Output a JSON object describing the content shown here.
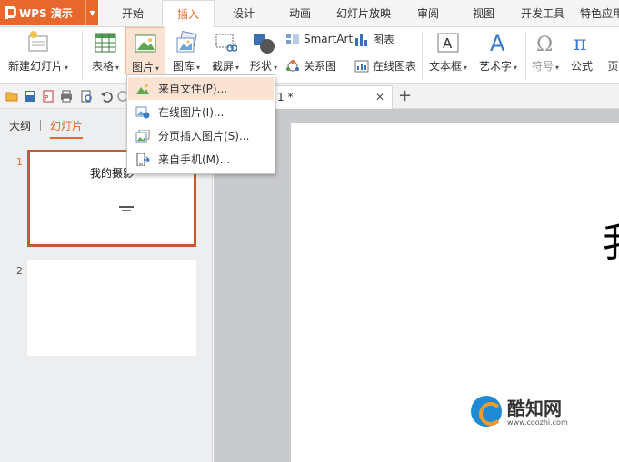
{
  "app": {
    "name": "WPS 演示",
    "dropdown_icon": "caret-down-icon"
  },
  "menu_tabs": [
    "开始",
    "插入",
    "设计",
    "动画",
    "幻灯片放映",
    "审阅",
    "视图",
    "开发工具",
    "特色应用"
  ],
  "active_tab": "插入",
  "ribbon": {
    "new_slide": "新建幻灯片",
    "table": "表格",
    "picture": "图片",
    "gallery": "图库",
    "screenshot": "截屏",
    "shapes": "形状",
    "smartart": "SmartArt",
    "chart": "图表",
    "relation": "关系图",
    "online_chart": "在线图表",
    "textbox": "文本框",
    "wordart": "艺术字",
    "symbol": "符号",
    "formula": "公式",
    "more": "页"
  },
  "document_tab": {
    "title": "1 *"
  },
  "left_pane": {
    "tabs": [
      "大纲",
      "幻灯片"
    ],
    "active_tab": "幻灯片",
    "slides": [
      {
        "number": "1",
        "title": "我的摄影"
      },
      {
        "number": "2",
        "title": ""
      }
    ]
  },
  "slide_canvas": {
    "visible_char": "我"
  },
  "picture_menu": {
    "items": [
      {
        "label": "来自文件(P)...",
        "icon": "image-file-icon"
      },
      {
        "label": "在线图片(I)...",
        "icon": "online-image-icon"
      },
      {
        "label": "分页插入图片(S)...",
        "icon": "paged-image-icon"
      },
      {
        "label": "来自手机(M)...",
        "icon": "phone-icon"
      }
    ]
  },
  "watermark": {
    "name": "酷知网",
    "url": "www.coozhi.com"
  },
  "colors": {
    "accent": "#e8672d",
    "hover": "#fbe3d4",
    "workspace": "#c9cacd"
  }
}
